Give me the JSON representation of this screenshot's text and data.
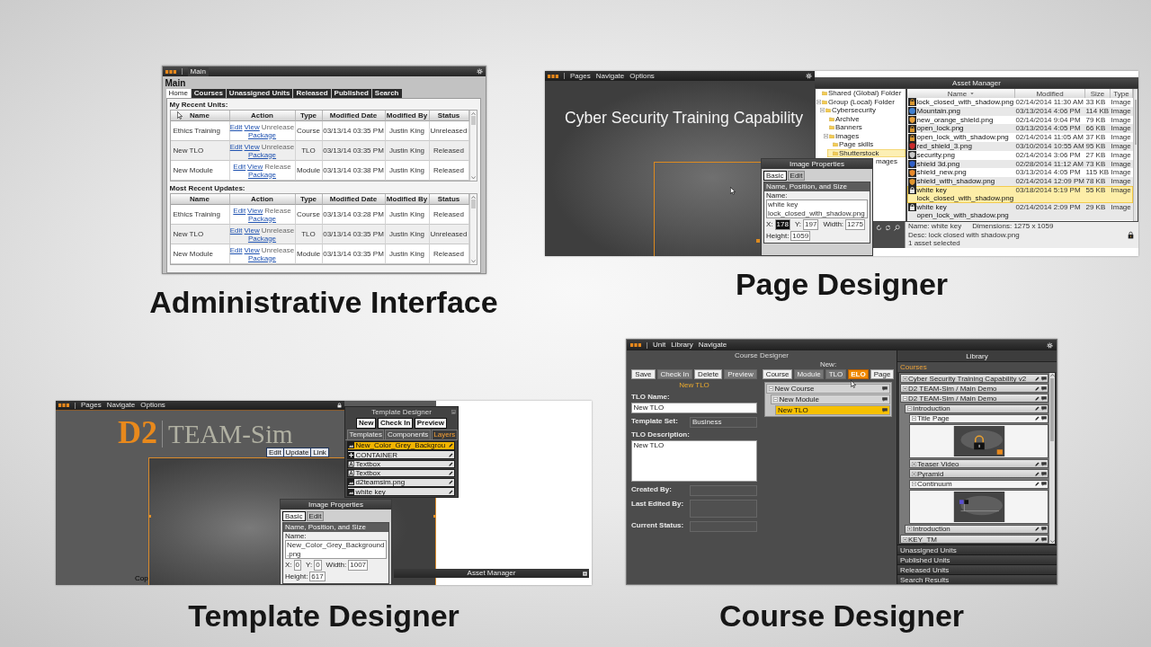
{
  "panels": [
    {
      "kind": "admin",
      "caption": "Administrative Interface",
      "screen": {
        "menu": [
          "Main"
        ],
        "title": "Main",
        "tabs": [
          {
            "label": "Home",
            "selected": true
          },
          {
            "label": "Courses",
            "selected": false
          },
          {
            "label": "Unassigned Units",
            "selected": false
          },
          {
            "label": "Released",
            "selected": false
          },
          {
            "label": "Published",
            "selected": false
          },
          {
            "label": "Search",
            "selected": false
          }
        ],
        "sections": [
          {
            "heading": "My Recent Units:",
            "columns": [
              "Name",
              "Action",
              "Type",
              "Modified Date",
              "Modified By",
              "Status"
            ],
            "rows": [
              {
                "name": "Ethics Training",
                "actions": [
                  {
                    "label": "Edit",
                    "disabled": false
                  },
                  {
                    "label": "View",
                    "disabled": false
                  },
                  {
                    "label": "Unrelease",
                    "disabled": true
                  },
                  {
                    "label": "Package",
                    "disabled": false
                  }
                ],
                "type": "Course",
                "modified": "03/13/14 03:35 PM",
                "modified_by": "Justin King",
                "status": "Unreleased"
              },
              {
                "name": "New TLO",
                "actions": [
                  {
                    "label": "Edit",
                    "disabled": false
                  },
                  {
                    "label": "View",
                    "disabled": false
                  },
                  {
                    "label": "Unrelease",
                    "disabled": true
                  },
                  {
                    "label": "Package",
                    "disabled": false
                  }
                ],
                "type": "TLO",
                "modified": "03/13/14 03:35 PM",
                "modified_by": "Justin King",
                "status": "Released"
              },
              {
                "name": "New Module",
                "actions": [
                  {
                    "label": "Edit",
                    "disabled": false
                  },
                  {
                    "label": "View",
                    "disabled": false
                  },
                  {
                    "label": "Release",
                    "disabled": true
                  },
                  {
                    "label": "Package",
                    "disabled": false
                  }
                ],
                "type": "Module",
                "modified": "03/13/14 03:38 PM",
                "modified_by": "Justin King",
                "status": "Released"
              }
            ]
          },
          {
            "heading": "Most Recent Updates:",
            "columns": [
              "Name",
              "Action",
              "Type",
              "Modified Date",
              "Modified By",
              "Status"
            ],
            "rows": [
              {
                "name": "Ethics Training",
                "actions": [
                  {
                    "label": "Edit",
                    "disabled": false
                  },
                  {
                    "label": "View",
                    "disabled": false
                  },
                  {
                    "label": "Release",
                    "disabled": true
                  },
                  {
                    "label": "Package",
                    "disabled": false
                  }
                ],
                "type": "Course",
                "modified": "03/13/14 03:28 PM",
                "modified_by": "Justin King",
                "status": "Released"
              },
              {
                "name": "New TLO",
                "actions": [
                  {
                    "label": "Edit",
                    "disabled": false
                  },
                  {
                    "label": "View",
                    "disabled": false
                  },
                  {
                    "label": "Unrelease",
                    "disabled": true
                  },
                  {
                    "label": "Package",
                    "disabled": false
                  }
                ],
                "type": "TLO",
                "modified": "03/13/14 03:35 PM",
                "modified_by": "Justin King",
                "status": "Unreleased"
              },
              {
                "name": "New Module",
                "actions": [
                  {
                    "label": "Edit",
                    "disabled": false
                  },
                  {
                    "label": "View",
                    "disabled": false
                  },
                  {
                    "label": "Unrelease",
                    "disabled": true
                  },
                  {
                    "label": "Package",
                    "disabled": false
                  }
                ],
                "type": "Module",
                "modified": "03/13/14 03:35 PM",
                "modified_by": "Justin King",
                "status": "Released"
              }
            ]
          }
        ]
      }
    },
    {
      "kind": "page_designer",
      "caption": "Page Designer",
      "screen": {
        "menu": [
          "Pages",
          "Navigate",
          "Options"
        ],
        "slide_title": "Cyber Security Training Capability",
        "properties": {
          "title": "Image Properties",
          "tabs": [
            {
              "label": "Basic",
              "selected": true
            },
            {
              "label": "Edit",
              "selected": false
            }
          ],
          "section": "Name, Position, and Size",
          "name_field": {
            "label": "Name:",
            "value": "white key lock_closed_with_shadow.png"
          },
          "fields": [
            {
              "label": "X:",
              "value": "178",
              "selected": true
            },
            {
              "label": "Y:",
              "value": "197",
              "selected": false
            },
            {
              "label": "Width:",
              "value": "1275",
              "selected": false
            },
            {
              "label": "Height:",
              "value": "1059",
              "selected": false
            }
          ]
        },
        "assets": {
          "title": "Asset Manager",
          "tree": [
            {
              "label": "Shared (Global) Folder",
              "selected": false,
              "covered": false
            },
            {
              "label": "Group (Local) Folder",
              "selected": false,
              "covered": false,
              "expanded": true,
              "children": [
                {
                  "label": "Cybersecurity",
                  "selected": false,
                  "covered": false,
                  "expanded": true,
                  "children": [
                    {
                      "label": "Archive",
                      "selected": false,
                      "covered": false
                    },
                    {
                      "label": "Banners",
                      "selected": false,
                      "covered": false
                    },
                    {
                      "label": "Images",
                      "selected": false,
                      "covered": false,
                      "expanded": true,
                      "children": [
                        {
                          "label": "Page skills",
                          "selected": false,
                          "covered": false
                        },
                        {
                          "label": "Shutterstock",
                          "selected": true,
                          "covered": false
                        }
                      ]
                    },
                    {
                      "label": "mages",
                      "selected": false,
                      "covered": true
                    }
                  ]
                }
              ]
            }
          ],
          "columns": [
            "Name",
            "Modified",
            "Size",
            "Type"
          ],
          "rows": [
            {
              "kind": "lock",
              "color": "#d9962e",
              "name": "lock_closed_with_shadow.png",
              "modified": "02/14/2014 11:30 AM",
              "size": "33 KB",
              "type": "Image",
              "selected": false
            },
            {
              "kind": "globe",
              "color": "#3f7fd0",
              "name": "Mountain.png",
              "modified": "03/13/2014 4:06 PM",
              "size": "114 KB",
              "type": "Image",
              "selected": false
            },
            {
              "kind": "shield",
              "color": "#e8a03a",
              "name": "new_orange_shield.png",
              "modified": "02/14/2014 9:04 PM",
              "size": "79 KB",
              "type": "Image",
              "selected": false
            },
            {
              "kind": "lock",
              "color": "#d9962e",
              "name": "open_lock.png",
              "modified": "03/13/2014 4:05 PM",
              "size": "66 KB",
              "type": "Image",
              "selected": false
            },
            {
              "kind": "lock",
              "color": "#d9962e",
              "name": "open_lock_with_shadow.png",
              "modified": "02/14/2014 11:05 AM",
              "size": "37 KB",
              "type": "Image",
              "selected": false
            },
            {
              "kind": "shield",
              "color": "#cc2b2b",
              "name": "red_shield_3.png",
              "modified": "03/10/2014 10:55 AM",
              "size": "95 KB",
              "type": "Image",
              "selected": false
            },
            {
              "kind": "shield",
              "color": "#c9c9c9",
              "name": "security.png",
              "modified": "02/14/2014 3:06 PM",
              "size": "27 KB",
              "type": "Image",
              "selected": false
            },
            {
              "kind": "shield",
              "color": "#2f5fc8",
              "name": "shield 3d.png",
              "modified": "02/28/2014 11:12 AM",
              "size": "73 KB",
              "type": "Image",
              "selected": false
            },
            {
              "kind": "shield",
              "color": "#e8892c",
              "name": "shield_new.png",
              "modified": "03/13/2014 4:05 PM",
              "size": "115 KB",
              "type": "Image",
              "selected": false
            },
            {
              "kind": "shield",
              "color": "#e0952e",
              "name": "shield_with_shadow.png",
              "modified": "02/14/2014 12:09 PM",
              "size": "78 KB",
              "type": "Image",
              "selected": false
            },
            {
              "kind": "lock",
              "color": "#e6e6e6",
              "name": "white key lock_closed_with_shadow.png",
              "modified": "03/18/2014 5:19 PM",
              "size": "55 KB",
              "type": "Image",
              "selected": true
            },
            {
              "kind": "lock",
              "color": "#e6e6e6",
              "name": "white key open_lock_with_shadow.png",
              "modified": "02/14/2014 2:09 PM",
              "size": "29 KB",
              "type": "Image",
              "selected": false
            }
          ],
          "details": {
            "name": "Name: white key",
            "dimensions": "Dimensions: 1275 x 1059",
            "description": "Desc: lock closed with shadow.png",
            "count": "1 asset selected"
          }
        }
      }
    },
    {
      "kind": "template_designer",
      "caption": "Template Designer",
      "screen": {
        "menu": [
          "Pages",
          "Navigate",
          "Options"
        ],
        "logo_mark": "D2",
        "logo_text": "TEAM-Sim",
        "canvas_buttons": [
          "Edit",
          "Update",
          "Link"
        ],
        "footer_text": "Cop",
        "designer": {
          "title": "Template Designer",
          "buttons": [
            "New",
            "Check In",
            "Preview"
          ],
          "tabs": [
            {
              "label": "Templates",
              "selected": false
            },
            {
              "label": "Components",
              "selected": false
            },
            {
              "label": "Layers",
              "selected": true
            }
          ],
          "layers": [
            {
              "kind": "image",
              "label": "New_Color_Grey_Backgrou",
              "selected": true
            },
            {
              "kind": "container",
              "label": "CONTAINER",
              "selected": false
            },
            {
              "kind": "text",
              "label": "Textbox",
              "selected": false
            },
            {
              "kind": "text",
              "label": "Textbox",
              "selected": false
            },
            {
              "kind": "image",
              "label": "d2teamsim.png",
              "selected": false
            },
            {
              "kind": "image",
              "label": "white key",
              "selected": false
            }
          ]
        },
        "properties": {
          "title": "Image Properties",
          "tabs": [
            {
              "label": "Basic",
              "selected": true
            },
            {
              "label": "Edit",
              "selected": false
            }
          ],
          "section": "Name, Position, and Size",
          "name_field": {
            "label": "Name:",
            "value": "New_Color_Grey_Background.png"
          },
          "fields": [
            {
              "label": "X:",
              "value": "0",
              "selected": false
            },
            {
              "label": "Y:",
              "value": "0",
              "selected": false
            },
            {
              "label": "Width:",
              "value": "1007",
              "selected": false
            },
            {
              "label": "Height:",
              "value": "617",
              "selected": false
            }
          ]
        },
        "asset_bar": "Asset Manager"
      }
    },
    {
      "kind": "course_designer",
      "caption": "Course Designer",
      "screen": {
        "menu": [
          "Unit",
          "Library",
          "Navigate"
        ],
        "title": "Course Designer",
        "actions": [
          {
            "label": "Save",
            "disabled": false
          },
          {
            "label": "Check In",
            "disabled": true
          },
          {
            "label": "Delete",
            "disabled": false
          },
          {
            "label": "Preview",
            "disabled": true
          }
        ],
        "unit_label": "New TLO",
        "form": [
          {
            "kind": "text",
            "label": "TLO Name:",
            "value": "New TLO"
          },
          {
            "kind": "inline",
            "label": "Template Set:",
            "value": "Business"
          },
          {
            "kind": "textarea",
            "label": "TLO Description:",
            "value": "New TLO"
          },
          {
            "kind": "inline",
            "label": "Created By:"
          },
          {
            "kind": "inline_tall",
            "label": "Last Edited By:"
          },
          {
            "kind": "inline",
            "label": "Current Status:"
          }
        ],
        "new_label": "New:",
        "new_buttons": [
          {
            "label": "Course",
            "disabled": false,
            "selected": false
          },
          {
            "label": "Module",
            "disabled": true,
            "selected": false
          },
          {
            "label": "TLO",
            "disabled": true,
            "selected": false
          },
          {
            "label": "ELO",
            "disabled": false,
            "selected": true
          },
          {
            "label": "Page",
            "disabled": false,
            "selected": false
          }
        ],
        "outline": [
          {
            "label": "New Course",
            "selected": false,
            "expanded": true,
            "children": [
              {
                "label": "New Module",
                "selected": false,
                "expanded": true,
                "children": [
                  {
                    "label": "New TLO",
                    "selected": true
                  }
                ]
              }
            ]
          }
        ],
        "library": {
          "title": "Library",
          "section": "Courses",
          "tree": [
            {
              "kind": "item",
              "label": "Cyber Security Training Capability v2",
              "expanded": false
            },
            {
              "kind": "item",
              "label": "D2 TEAM-Sim / Main Demo",
              "expanded": false
            },
            {
              "kind": "item",
              "label": "D2 TEAM-Sim / Main Demo",
              "expanded": true,
              "children": [
                {
                  "kind": "item",
                  "label": "Introduction",
                  "expanded": true,
                  "children": [
                    {
                      "kind": "preview_lock",
                      "label": "Title Page",
                      "expanded": true
                    },
                    {
                      "kind": "item",
                      "label": "Teaser Video",
                      "expanded": false
                    },
                    {
                      "kind": "item",
                      "label": "Pyramid",
                      "expanded": false
                    },
                    {
                      "kind": "preview_timeline",
                      "label": "Continuum",
                      "expanded": true
                    }
                  ]
                },
                {
                  "kind": "item",
                  "label": "Introduction",
                  "expanded": false
                }
              ]
            },
            {
              "kind": "item",
              "label": "KEY_TM",
              "expanded": false
            }
          ],
          "accordions": [
            "Unassigned Units",
            "Published Units",
            "Released Units",
            "Search Results"
          ]
        }
      }
    }
  ]
}
